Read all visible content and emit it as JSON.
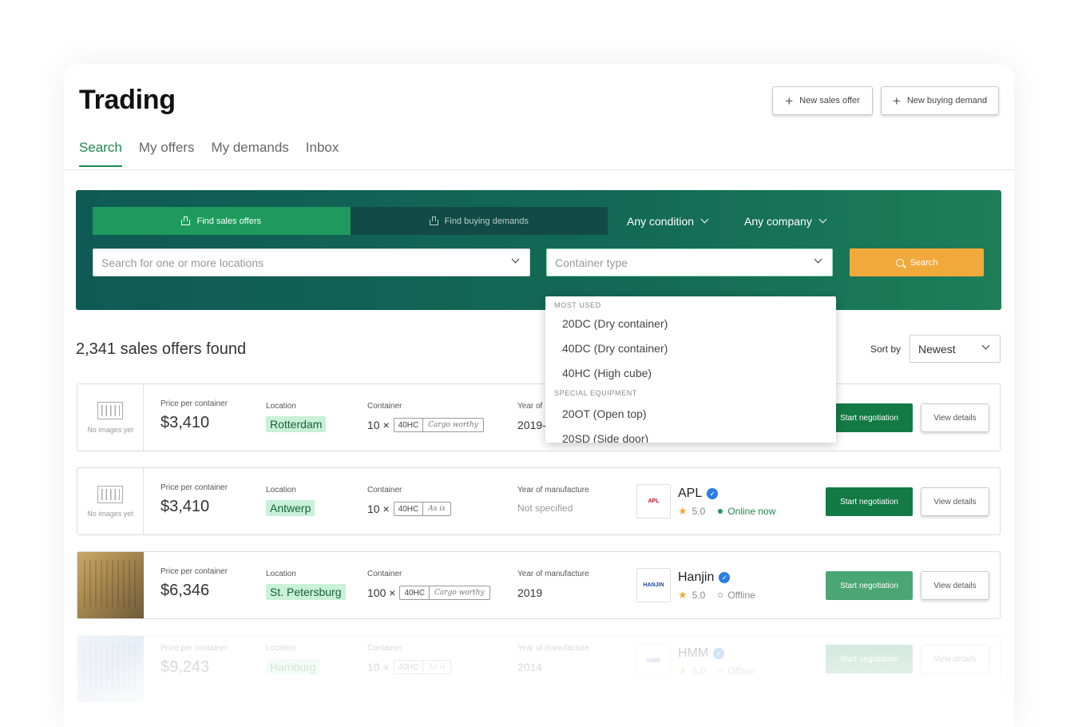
{
  "app": {
    "title": "Trading"
  },
  "header": {
    "new_offer_label": "New sales offer",
    "new_demand_label": "New buying demand"
  },
  "tabs": [
    {
      "label": "Search",
      "active": true
    },
    {
      "label": "My offers",
      "active": false
    },
    {
      "label": "My demands",
      "active": false
    },
    {
      "label": "Inbox",
      "active": false
    }
  ],
  "search": {
    "mode_sales": "Find sales offers",
    "mode_buying": "Find buying demands",
    "condition": "Any condition",
    "company": "Any company",
    "location_placeholder": "Search for one or more locations",
    "container_placeholder": "Container type",
    "button": "Search"
  },
  "container_dropdown": {
    "groups": [
      {
        "header": "MOST USED",
        "items": [
          "20DC (Dry container)",
          "40DC (Dry container)",
          "40HC (High cube)"
        ]
      },
      {
        "header": "SPECIAL EQUIPMENT",
        "items": [
          "20OT (Open top)",
          "20SD (Side door)"
        ]
      }
    ]
  },
  "results": {
    "count_text": "2,341 sales offers found",
    "sort_label": "Sort by",
    "sort_value": "Newest"
  },
  "labels": {
    "price": "Price per container",
    "location": "Location",
    "container": "Container",
    "year": "Year of manufacture",
    "no_images": "No images yet",
    "start_negotiation": "Start negotiation",
    "view_details": "View details",
    "year_truncated": "Year of"
  },
  "offers": [
    {
      "image": "none",
      "price": "$3,410",
      "location": "Rotterdam",
      "qty": "10 ×",
      "type": "40HC",
      "condition": "Cargo worthy",
      "year": "2019-",
      "company": "",
      "rating": "",
      "status": ""
    },
    {
      "image": "none",
      "price": "$3,410",
      "location": "Antwerp",
      "qty": "10 ×",
      "type": "40HC",
      "condition": "As is",
      "year": "Not specified",
      "company": "APL",
      "logo_text": "APL",
      "rating": "5.0",
      "status": "Online now"
    },
    {
      "image": "photo",
      "price": "$6,346",
      "location": "St. Petersburg",
      "qty": "100 ×",
      "type": "40HC",
      "condition": "Cargo worthy",
      "year": "2019",
      "company": "Hanjin",
      "logo_text": "HANJIN",
      "rating": "5.0",
      "status": "Offline"
    },
    {
      "image": "photo",
      "price": "$9,243",
      "location": "Hamburg",
      "qty": "10 ×",
      "type": "40HC",
      "condition": "As is",
      "year": "2014",
      "company": "HMM",
      "logo_text": "HMM",
      "rating": "5.0",
      "status": "Offline"
    }
  ],
  "colors": {
    "brand_green": "#1d8a4e",
    "search_orange": "#f2a93c",
    "panel_teal": "#0f5a55"
  }
}
